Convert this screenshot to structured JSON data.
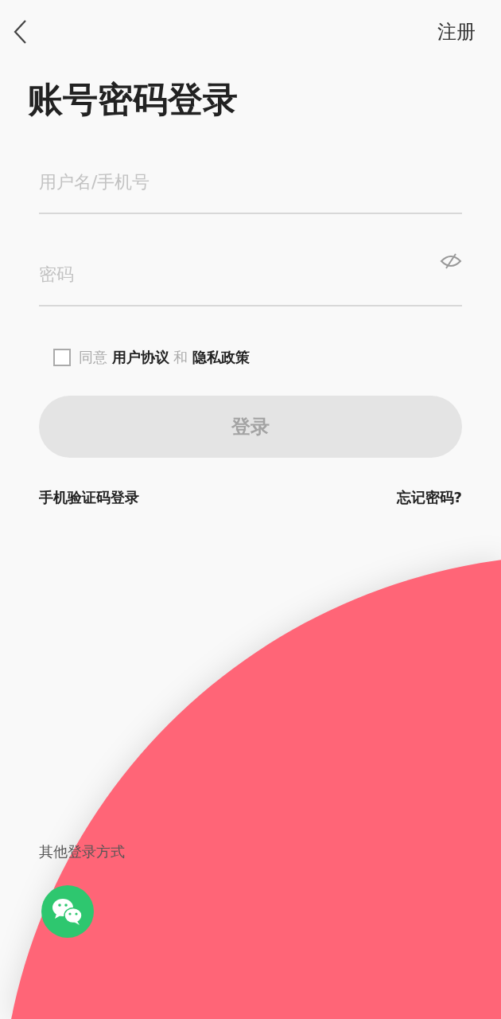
{
  "header": {
    "register": "注册"
  },
  "title": "账号密码登录",
  "username": {
    "placeholder": "用户名/手机号"
  },
  "password": {
    "placeholder": "密码",
    "visible": false
  },
  "agreement": {
    "checked": false,
    "prefix": "同意",
    "terms": "用户协议",
    "joiner": "和",
    "privacy": "隐私政策"
  },
  "login_button": {
    "label": "登录",
    "disabled": true
  },
  "links": {
    "sms_login": "手机验证码登录",
    "forgot": "忘记密码?"
  },
  "other_login": {
    "label": "其他登录方式"
  }
}
